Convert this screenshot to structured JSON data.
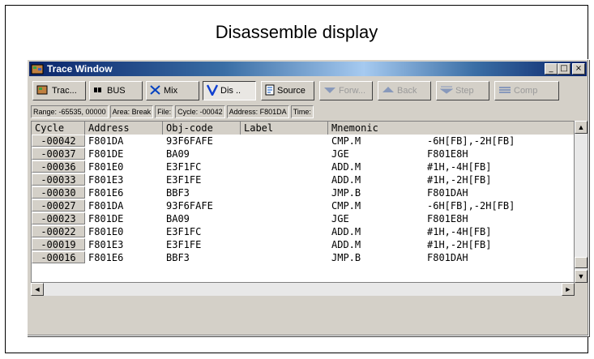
{
  "caption": "Disassemble display",
  "window": {
    "title": "Trace Window",
    "buttons": [
      "_",
      "□",
      "×"
    ]
  },
  "toolbar": [
    {
      "label": "Trac...",
      "icon": "trace-icon",
      "state": "normal"
    },
    {
      "label": "BUS",
      "icon": "bus-icon",
      "state": "normal"
    },
    {
      "label": "Mix",
      "icon": "mix-icon",
      "state": "normal"
    },
    {
      "label": "Dis ..",
      "icon": "disassemble-icon",
      "state": "pressed"
    },
    {
      "label": "Source",
      "icon": "source-icon",
      "state": "normal"
    },
    {
      "label": "Forw...",
      "icon": "forward-icon",
      "state": "disabled"
    },
    {
      "label": "Back",
      "icon": "back-icon",
      "state": "disabled"
    },
    {
      "label": "Step",
      "icon": "step-icon",
      "state": "disabled"
    },
    {
      "label": "Comp",
      "icon": "compare-icon",
      "state": "disabled"
    }
  ],
  "status": {
    "range": "Range: -65535, 00000",
    "area": "Area: Break",
    "file": "File:",
    "cycle": "Cycle: -00042",
    "address": "Address: F801DA",
    "time": "Time:"
  },
  "columns": {
    "cycle": "Cycle",
    "address": "Address",
    "objcode": "Obj-code",
    "label": "Label",
    "mnemonic": "Mnemonic"
  },
  "rows": [
    {
      "cycle": "-00042",
      "address": "F801DA",
      "obj": "93F6FAFE",
      "label": "",
      "op": "CMP.M",
      "operand": "-6H[FB],-2H[FB]"
    },
    {
      "cycle": "-00037",
      "address": "F801DE",
      "obj": "BA09",
      "label": "",
      "op": "JGE",
      "operand": "F801E8H"
    },
    {
      "cycle": "-00036",
      "address": "F801E0",
      "obj": "E3F1FC",
      "label": "",
      "op": "ADD.M",
      "operand": "#1H,-4H[FB]"
    },
    {
      "cycle": "-00033",
      "address": "F801E3",
      "obj": "E3F1FE",
      "label": "",
      "op": "ADD.M",
      "operand": "#1H,-2H[FB]"
    },
    {
      "cycle": "-00030",
      "address": "F801E6",
      "obj": "BBF3",
      "label": "",
      "op": "JMP.B",
      "operand": "F801DAH"
    },
    {
      "cycle": "-00027",
      "address": "F801DA",
      "obj": "93F6FAFE",
      "label": "",
      "op": "CMP.M",
      "operand": "-6H[FB],-2H[FB]"
    },
    {
      "cycle": "-00023",
      "address": "F801DE",
      "obj": "BA09",
      "label": "",
      "op": "JGE",
      "operand": "F801E8H"
    },
    {
      "cycle": "-00022",
      "address": "F801E0",
      "obj": "E3F1FC",
      "label": "",
      "op": "ADD.M",
      "operand": "#1H,-4H[FB]"
    },
    {
      "cycle": "-00019",
      "address": "F801E3",
      "obj": "E3F1FE",
      "label": "",
      "op": "ADD.M",
      "operand": "#1H,-2H[FB]"
    },
    {
      "cycle": "-00016",
      "address": "F801E6",
      "obj": "BBF3",
      "label": "",
      "op": "JMP.B",
      "operand": "F801DAH"
    }
  ],
  "scroll": {
    "up": "▲",
    "down": "▼",
    "left": "◄",
    "right": "►"
  },
  "colors": {
    "titlebar_start": "#0a246a",
    "titlebar_end": "#a6caf0",
    "face": "#d4d0c8"
  }
}
